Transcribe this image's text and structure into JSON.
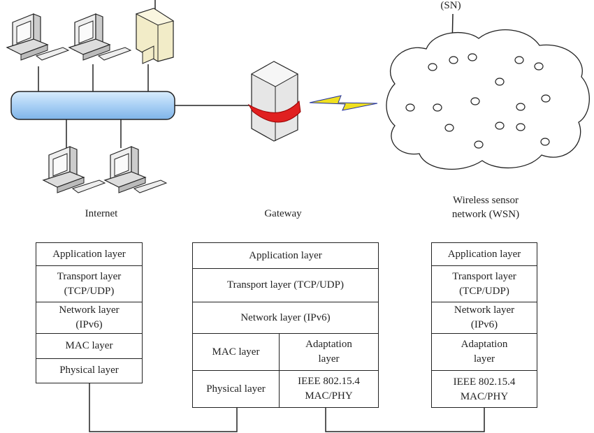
{
  "labels": {
    "internet": "Internet",
    "gateway": "Gateway",
    "wsn_line1": "Wireless sensor",
    "wsn_line2": "network (WSN)",
    "sn": "(SN)"
  },
  "stacks": {
    "internet": [
      "Application layer",
      "Transport layer (TCP/UDP)",
      "Network layer (IPv6)",
      "MAC layer",
      "Physical layer"
    ],
    "gateway": {
      "full": [
        "Application layer",
        "Transport layer (TCP/UDP)",
        "Network layer (IPv6)"
      ],
      "left": [
        "MAC layer",
        "Physical layer"
      ],
      "right": [
        "Adaptation layer",
        "IEEE 802.15.4 MAC/PHY"
      ]
    },
    "wsn": [
      "Application layer",
      "Transport layer (TCP/UDP)",
      "Network layer (IPv6)",
      "Adaptation layer",
      "IEEE 802.15.4 MAC/PHY"
    ]
  },
  "colors": {
    "bus": "#a9d0f5",
    "gateway_arrow": "#e02020",
    "wireless_bolt": "#f0e020",
    "server": "#f2ecc8"
  }
}
